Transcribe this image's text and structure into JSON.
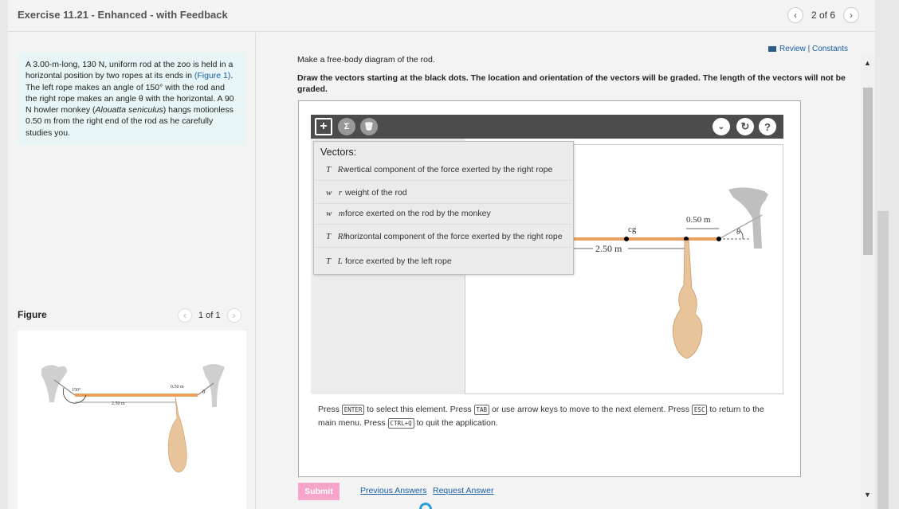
{
  "header": {
    "title": "Exercise 11.21 - Enhanced - with Feedback",
    "position": "2 of 6"
  },
  "problem": {
    "text_before_link": "A 3.00-m-long, 130 N, uniform rod at the zoo is held in a horizontal position by two ropes at its ends in ",
    "link": "(Figure 1)",
    "text_after_link": ". The left rope makes an angle of 150° with the rod and the right rope makes an angle θ with the horizontal. A 90 N howler monkey (",
    "species": "Alouatta seniculus",
    "text_end": ") hangs motionless 0.50 m from the right end of the rod as he carefully studies you."
  },
  "figure": {
    "label": "Figure",
    "pager": "1 of 1",
    "angle_label": "150°",
    "length_label": "2.50 m",
    "offset_label": "0.50 m",
    "theta_label": "θ"
  },
  "main": {
    "review_link": "Review | Constants",
    "instruction": "Make a free-body diagram of the rod.",
    "instruction_bold": "Draw the vectors starting at the black dots. The location and orientation of the vectors will be graded. The length of the vectors will not be graded."
  },
  "toolbar": {
    "icons": [
      "plus-icon",
      "sigma-icon",
      "trash-icon",
      "chevron-down-icon",
      "reset-icon",
      "help-icon"
    ]
  },
  "vectors_menu": {
    "title": "Vectors:",
    "items": [
      {
        "symbol": "T⃗Rv",
        "label": "vertical component of the force exerted by the right rope"
      },
      {
        "symbol": "w⃗r",
        "label": "weight of the rod"
      },
      {
        "symbol": "w⃗m",
        "label": "force exerted on the rod by the monkey"
      },
      {
        "symbol": "T⃗Rh",
        "label": "horizontal component of the force exerted by the right rope"
      },
      {
        "symbol": "T⃗L",
        "label": "force exerted by the left rope"
      }
    ]
  },
  "canvas": {
    "cg_label": "cg",
    "length_label": "2.50 m",
    "offset_label": "0.50 m",
    "theta_label": "θ"
  },
  "hint": {
    "p1": "Press",
    "k1": "ENTER",
    "p2": "to select this element. Press",
    "k2": "TAB",
    "p3": "or use arrow keys to move to the next element. Press",
    "k3": "ESC",
    "p4": "to return to the main menu. Press",
    "k4": "CTRL+Q",
    "p5": "to quit the application."
  },
  "actions": {
    "submit": "Submit",
    "previous_answers": "Previous Answers",
    "request_answer": "Request Answer"
  },
  "colors": {
    "rod": "#e8a060",
    "monkey": "#e8c49a",
    "accent_link": "#1a5fa3",
    "submit_bg": "#f4a5c9"
  }
}
